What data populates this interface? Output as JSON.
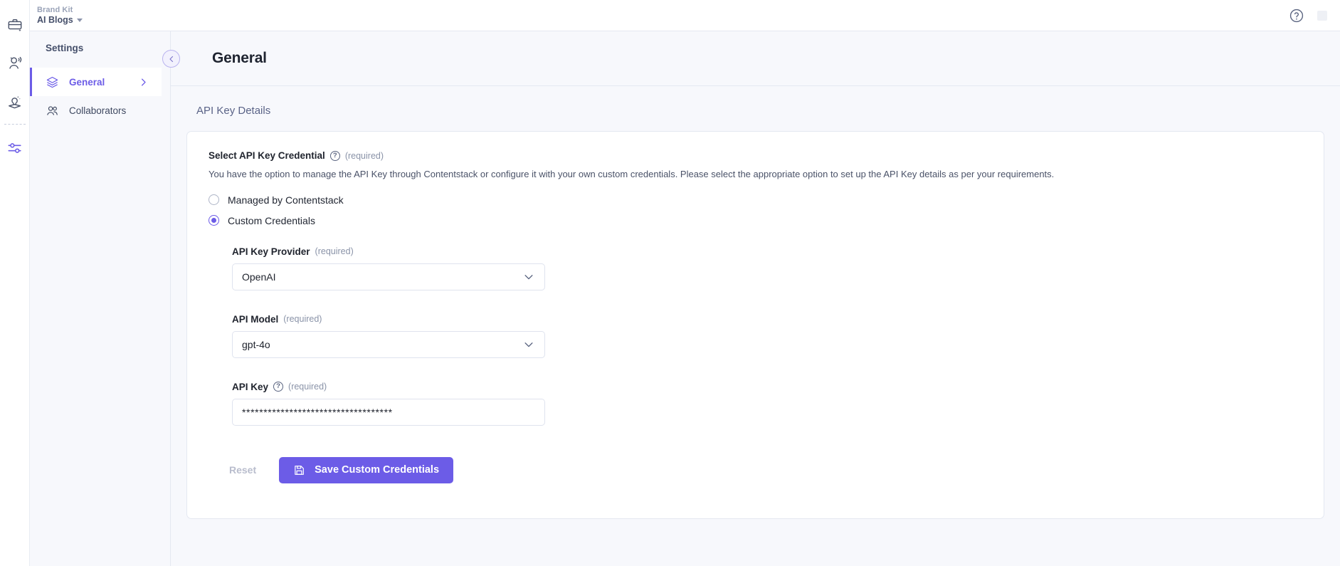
{
  "topbar": {
    "brand_kit_label": "Brand Kit",
    "brand_name": "AI Blogs",
    "dropdown_icon": "chevron-down-icon",
    "help_icon": "help-circle-icon"
  },
  "rail": {
    "items": [
      {
        "icon": "briefcase-sparkle-icon",
        "active": false
      },
      {
        "icon": "voice-profile-icon",
        "active": false
      },
      {
        "icon": "idea-lightbulb-icon",
        "active": false
      },
      {
        "icon": "settings-sliders-icon",
        "active": true
      }
    ]
  },
  "sidebar": {
    "title": "Settings",
    "items": [
      {
        "label": "General",
        "icon": "layers-icon",
        "active": true,
        "chevron": "chevron-right-icon"
      },
      {
        "label": "Collaborators",
        "icon": "users-icon",
        "active": false
      }
    ],
    "collapse_icon": "chevron-left-icon"
  },
  "page": {
    "title": "General",
    "section_heading": "API Key Details"
  },
  "credential": {
    "label": "Select API Key Credential",
    "help_icon": "help-circle-icon",
    "required": "(required)",
    "helper_text": "You have the option to manage the API Key through Contentstack or configure it with your own custom credentials. Please select the appropriate option to set up the API Key details as per your requirements.",
    "options": [
      {
        "label": "Managed by Contentstack",
        "selected": false
      },
      {
        "label": "Custom Credentials",
        "selected": true
      }
    ]
  },
  "fields": {
    "provider": {
      "label": "API Key Provider",
      "required": "(required)",
      "value": "OpenAI",
      "chevron": "chevron-down-icon"
    },
    "model": {
      "label": "API Model",
      "required": "(required)",
      "value": "gpt-4o",
      "chevron": "chevron-down-icon"
    },
    "api_key": {
      "label": "API Key",
      "help_icon": "help-circle-icon",
      "required": "(required)",
      "value": "***********************************"
    }
  },
  "actions": {
    "reset_label": "Reset",
    "save_label": "Save Custom Credentials",
    "save_icon": "floppy-save-icon"
  },
  "colors": {
    "accent": "#6c5ce7",
    "page_bg": "#f7f8fc",
    "card_bg": "#ffffff",
    "border": "#e4e8f1",
    "text": "#20242e",
    "muted": "#8a93a8"
  }
}
